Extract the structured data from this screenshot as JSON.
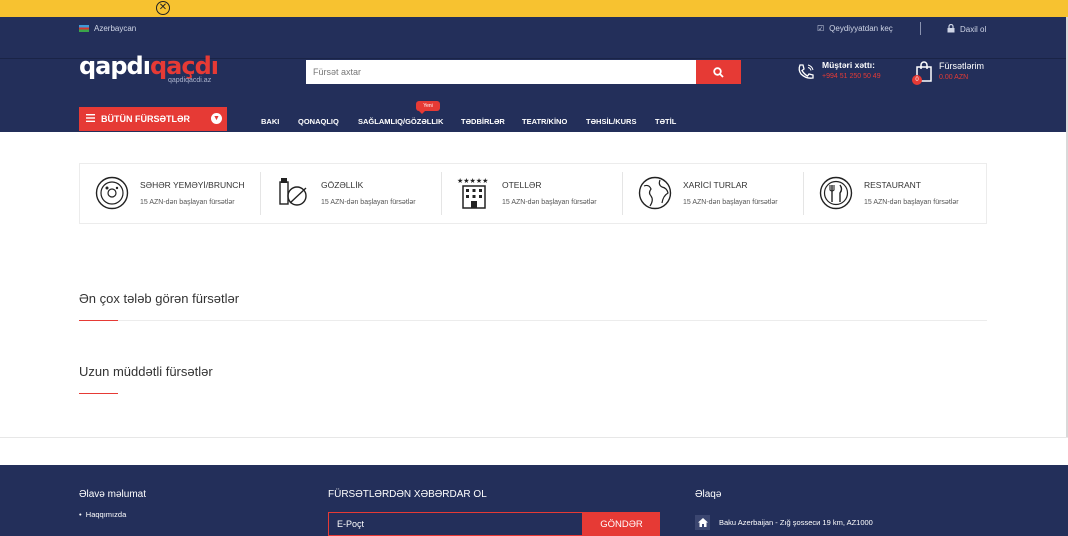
{
  "topbar": {
    "close_icon": "close-circle-icon"
  },
  "header": {
    "language": "Azerbaycan",
    "register": "Qeydiyyatdan keç",
    "login": "Daxil ol",
    "logo_part1": "qapdı",
    "logo_part2": "qaçdı",
    "logo_sub": "qapdiqacdi.az",
    "search_placeholder": "Fürsət axtar",
    "hotline_title": "Müştəri xəttı:",
    "hotline_number": "+994 51 250 50 49",
    "cart_title": "Fürsətlərim",
    "cart_sum": "0.00 AZN",
    "cart_count": "0",
    "all_deals": "BÜTÜN FÜRSƏTLƏR",
    "new_badge": "Yeni",
    "nav": [
      "BAKI",
      "QONAQLIQ",
      "SAĞLAMLIQ/GÖZƏLLIK",
      "TƏDBİRLƏR",
      "TEATR/KİNO",
      "TƏHSİL/KURS",
      "TƏTİL"
    ]
  },
  "categories": [
    {
      "title": "SƏHƏR YEMƏYİ/BRUNCH",
      "sub": "15 AZN-dən başlayan fürsətlər",
      "icon": "breakfast-plate-icon"
    },
    {
      "title": "GÖZƏLLİK",
      "sub": "15 AZN-dən başlayan fürsətlər",
      "icon": "cosmetics-icon"
    },
    {
      "title": "OTELLƏR",
      "sub": "15 AZN-dən başlayan fürsətlər",
      "icon": "hotel-icon"
    },
    {
      "title": "XARİCİ TURLAR",
      "sub": "15 AZN-dən başlayan fürsətlər",
      "icon": "globe-icon"
    },
    {
      "title": "RESTAURANT",
      "sub": "15 AZN-dən başlayan fürsətlər",
      "icon": "restaurant-icon"
    }
  ],
  "sections": {
    "popular": "Ən çox tələb görən fürsətlər",
    "longterm": "Uzun müddətli fürsətlər"
  },
  "footer": {
    "col1_title": "Əlavə məlumat",
    "col1_item": "Haqqımızda",
    "col2_title": "FÜRSƏTLƏRDƏN XƏBƏRDAR OL",
    "email_placeholder": "E-Poçt",
    "send": "GÖNDƏR",
    "col3_title": "Əlaqə",
    "address": "Baku Azerbaijan - Zığ şosseси 19 km, AZ1000"
  }
}
